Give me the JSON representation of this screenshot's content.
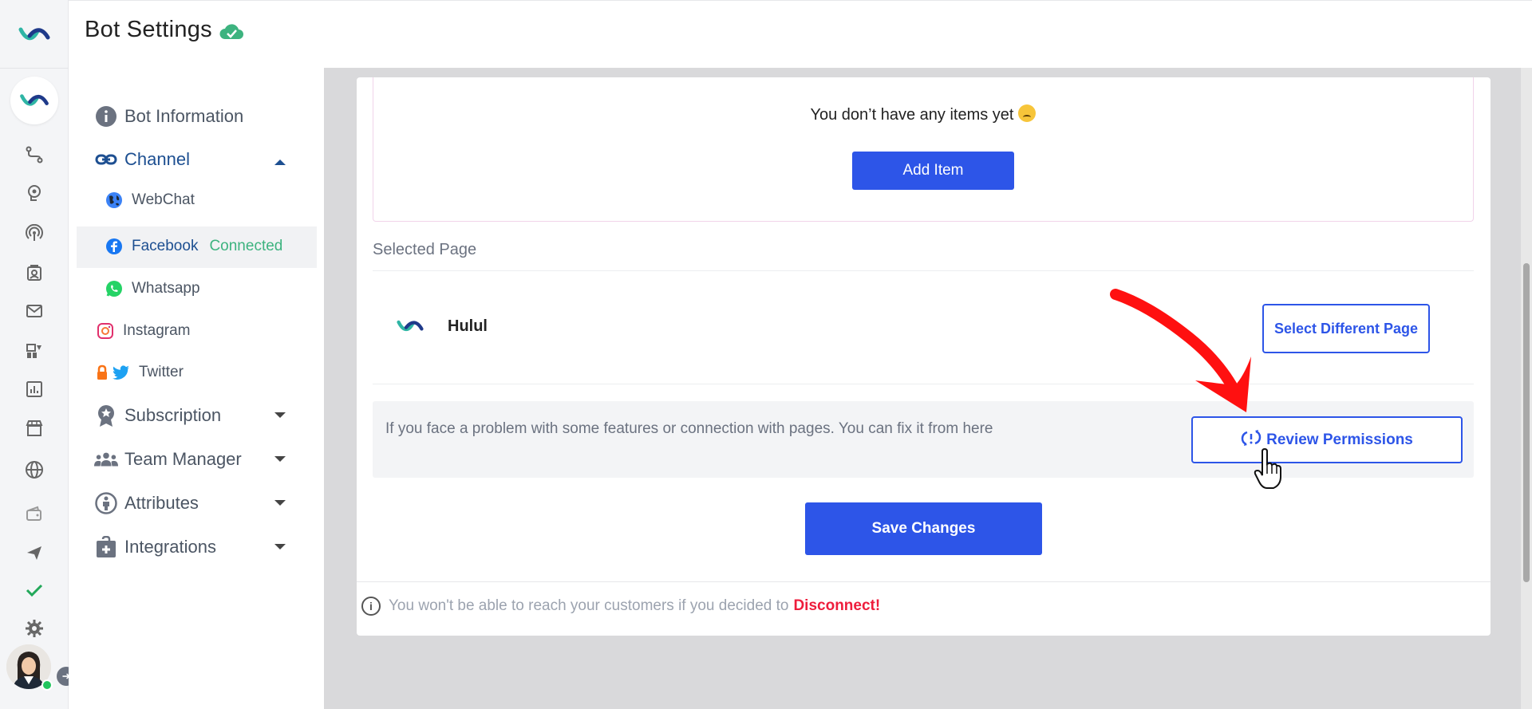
{
  "header": {
    "title": "Bot Settings"
  },
  "sidebar": {
    "items": [
      {
        "label": "Bot Information"
      },
      {
        "label": "Channel"
      },
      {
        "label": "Subscription"
      },
      {
        "label": "Team Manager"
      },
      {
        "label": "Attributes"
      },
      {
        "label": "Integrations"
      }
    ],
    "channels": [
      {
        "label": "WebChat"
      },
      {
        "label": "Facebook",
        "status": "Connected"
      },
      {
        "label": "Whatsapp"
      },
      {
        "label": "Instagram"
      },
      {
        "label": "Twitter"
      }
    ]
  },
  "rail": {
    "icons": [
      "flow-icon",
      "brain-icon",
      "broadcast-icon",
      "contacts-icon",
      "mail-icon",
      "widgets-icon",
      "analytics-icon",
      "store-icon",
      "globe-icon",
      "wallet-icon",
      "send-icon",
      "check-icon",
      "settings-icon"
    ]
  },
  "main": {
    "empty_message": "You don’t have any items yet",
    "add_item_label": "Add Item",
    "selected_page_label": "Selected Page",
    "page_name": "Hulul",
    "select_different_label": "Select Different Page",
    "notice_text": "If you face a problem with some features or connection with pages. You can fix it from here",
    "review_permissions_label": "Review Permissions",
    "save_label": "Save Changes",
    "footer_text": "You won't be able to reach your customers if you decided to",
    "footer_danger": "Disconnect!"
  },
  "colors": {
    "primary": "#2d55e8",
    "success": "#3db37f",
    "danger": "#ee1d3c",
    "annotation": "#ff1010"
  }
}
